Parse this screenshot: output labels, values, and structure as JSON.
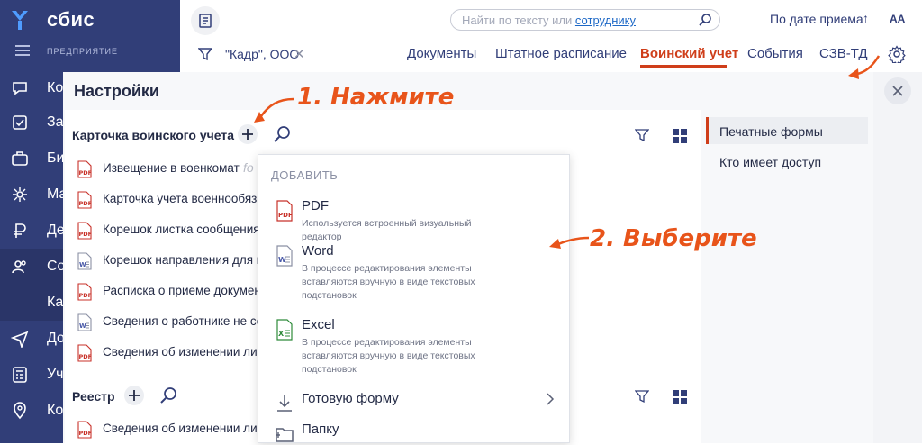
{
  "brand": {
    "name": "сбис",
    "org": "ПРЕДПРИЯТИЕ"
  },
  "sidebar": {
    "items": [
      {
        "label": "Ко",
        "icon": "chat-icon"
      },
      {
        "label": "За",
        "icon": "tasks-icon"
      },
      {
        "label": "Би",
        "icon": "briefcase-icon"
      },
      {
        "label": "Ма",
        "icon": "marketing-icon"
      },
      {
        "label": "Де",
        "icon": "money-icon"
      },
      {
        "label": "Со",
        "icon": "people-icon"
      },
      {
        "label": "Ка",
        "icon": ""
      },
      {
        "label": "До",
        "icon": "send-icon"
      },
      {
        "label": "Уч",
        "icon": "calculator-icon"
      },
      {
        "label": "Ко",
        "icon": "location-icon"
      }
    ]
  },
  "header": {
    "search_placeholder": "Найти по тексту или",
    "search_link": "сотруднику",
    "sort_label": "По дате приема",
    "sort_arrow": "↑",
    "font_size_label": "АА",
    "filter_value": "\"Кадр\", ООО",
    "filter_clear": "✕",
    "tabs": [
      {
        "label": "Документы"
      },
      {
        "label": "Штатное расписание"
      },
      {
        "label": "Воинский учет"
      },
      {
        "label": "События"
      },
      {
        "label": "СЗВ-ТД"
      }
    ]
  },
  "settings": {
    "title": "Настройки",
    "section1": {
      "title": "Карточка воинского учета",
      "items": [
        {
          "label": "Извещение в военкомат",
          "type": "pdf"
        },
        {
          "label": "Карточка учета военнообязанного",
          "type": "pdf"
        },
        {
          "label": "Корешок листка сообщения",
          "type": "pdf"
        },
        {
          "label": "Корешок направления для п",
          "type": "word"
        },
        {
          "label": "Расписка о приеме документов",
          "type": "pdf"
        },
        {
          "label": "Сведения о работнике не со",
          "type": "word"
        },
        {
          "label": "Сведения об изменении лич",
          "type": "pdf"
        }
      ]
    },
    "section2": {
      "title": "Реестр",
      "items": [
        {
          "label": "Сведения об изменении лич",
          "type": "pdf"
        }
      ]
    },
    "right_menu": [
      {
        "label": "Печатные формы",
        "active": true
      },
      {
        "label": "Кто имеет доступ",
        "active": false
      }
    ],
    "ghost_text": "fo"
  },
  "dropdown": {
    "title": "ДОБАВИТЬ",
    "items": [
      {
        "label": "PDF",
        "desc": "Используется встроенный визуальный редактор",
        "icon": "pdf-file-icon"
      },
      {
        "label": "Word",
        "desc": "В процессе редактирования элементы вставляются вручную в виде текстовых подстановок",
        "icon": "word-file-icon"
      },
      {
        "label": "Excel",
        "desc": "В процессе редактирования элементы вставляются вручную в виде текстовых подстановок",
        "icon": "excel-file-icon"
      },
      {
        "label": "Готовую форму",
        "desc": "",
        "icon": "download-icon"
      },
      {
        "label": "Папку",
        "desc": "",
        "icon": "folder-icon"
      }
    ]
  },
  "annotations": {
    "step1": "1. Нажмите",
    "step2": "2. Выберите"
  },
  "colors": {
    "sidebar": "#313E78",
    "accent": "#cf3e1a",
    "annotation": "#e8541a",
    "pdf": "#c8322a",
    "word": "#4a5aa8",
    "excel": "#2e8b3a"
  }
}
